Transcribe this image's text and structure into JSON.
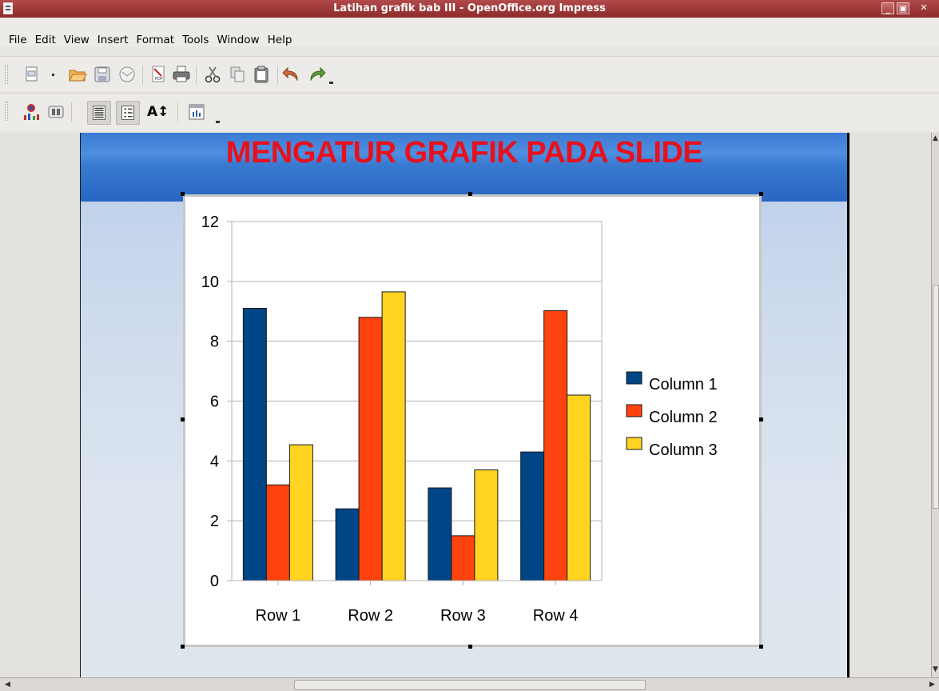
{
  "window": {
    "title": "Latihan grafik bab III - OpenOffice.org Impress"
  },
  "menu": [
    "File",
    "Edit",
    "View",
    "Insert",
    "Format",
    "Tools",
    "Window",
    "Help"
  ],
  "toolbar1": [
    "new-document-icon",
    "dropdown-arrow-icon",
    "open-folder-icon",
    "save-icon",
    "email-icon",
    "export-pdf-icon",
    "print-icon",
    "cut-icon",
    "copy-icon",
    "paste-icon",
    "undo-icon",
    "redo-icon"
  ],
  "toolbar2": [
    "chart-type-icon",
    "chart-data-table-icon",
    "title-on-off-icon",
    "legend-on-off-icon",
    "scale-text-icon",
    "data-in-rows-icon"
  ],
  "slide": {
    "title": "MENGATUR GRAFIK PADA SLIDE",
    "header_color": "#3a7bd2",
    "title_color": "#e8101c"
  },
  "chart_data": {
    "type": "bar",
    "categories": [
      "Row 1",
      "Row 2",
      "Row 3",
      "Row 4"
    ],
    "series": [
      {
        "name": "Column 1",
        "color": "#004586",
        "values": [
          9.1,
          2.4,
          3.1,
          4.3
        ]
      },
      {
        "name": "Column 2",
        "color": "#ff420e",
        "values": [
          3.2,
          8.8,
          1.5,
          9.02
        ]
      },
      {
        "name": "Column 3",
        "color": "#ffd320",
        "values": [
          4.54,
          9.65,
          3.7,
          6.2
        ]
      }
    ],
    "ylim": [
      0,
      12
    ],
    "yticks": [
      "0",
      "2",
      "4",
      "6",
      "8",
      "10",
      "12"
    ],
    "grid": true,
    "legend": "right"
  }
}
